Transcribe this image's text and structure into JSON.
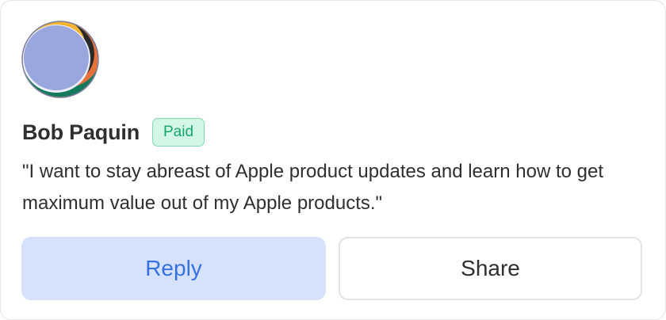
{
  "user": {
    "name": "Bob Paquin",
    "badge": "Paid",
    "quote": "\"I want to stay abreast of Apple product updates and learn how to get maximum value out of my Apple products.\""
  },
  "actions": {
    "reply_label": "Reply",
    "share_label": "Share"
  },
  "colors": {
    "badge_bg": "#d3f6e6",
    "badge_text": "#14a86a",
    "reply_bg": "#d6e2fb",
    "reply_text": "#3470e4",
    "avatar_main": "#9aa6de",
    "avatar_yellow": "#f5b531",
    "avatar_orange": "#e8703a",
    "avatar_green": "#137a5c"
  },
  "icons": {
    "avatar": "abstract-colorful-avatar"
  }
}
